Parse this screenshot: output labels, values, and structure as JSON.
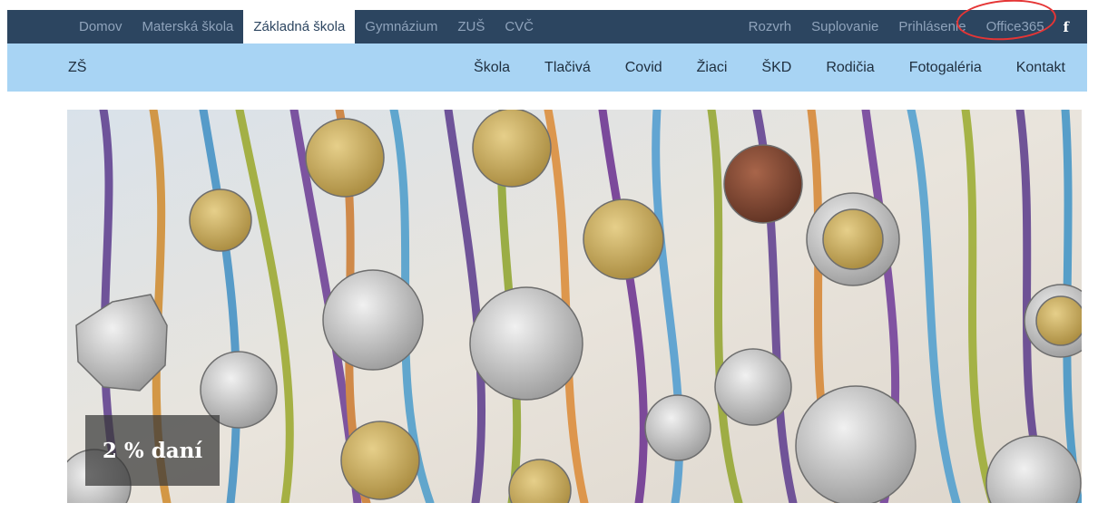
{
  "top_nav": {
    "left": [
      "Domov",
      "Materská škola",
      "Základná škola",
      "Gymnázium",
      "ZUŠ",
      "CVČ"
    ],
    "active": "Základná škola",
    "right": [
      "Rozvrh",
      "Suplovanie",
      "Prihlásenie",
      "Office365"
    ],
    "facebook_icon": "facebook-icon",
    "annotation_color": "#e53535"
  },
  "sub_nav": {
    "brand": "ZŠ",
    "links": [
      "Škola",
      "Tlačivá",
      "Covid",
      "Žiaci",
      "ŠKD",
      "Rodičia",
      "Fotogaléria",
      "Kontakt"
    ]
  },
  "hero": {
    "caption": "2 % daní"
  },
  "colors": {
    "top_bar": "#2c4560",
    "sub_bar": "#a8d4f4",
    "text_dark": "#203040"
  }
}
